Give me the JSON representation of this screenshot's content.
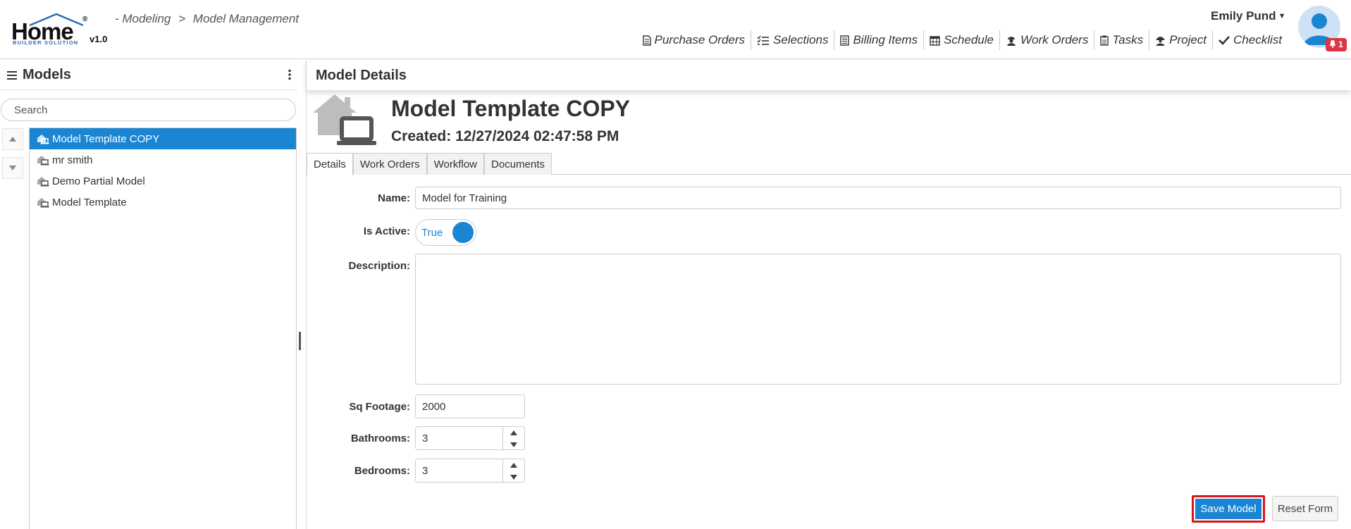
{
  "app": {
    "logo_word": "Home",
    "logo_reg": "®",
    "logo_sub": "BUILDER SOLUTION",
    "version": "v1.0",
    "accent_color": "#1a85d3"
  },
  "breadcrumb": {
    "section": "- Modeling",
    "separator": ">",
    "page": "Model Management"
  },
  "user": {
    "name": "Emily Pund",
    "notification_count": "1"
  },
  "nav": [
    {
      "label": "Purchase Orders",
      "icon": "document-icon"
    },
    {
      "label": "Selections",
      "icon": "checklist-icon"
    },
    {
      "label": "Billing Items",
      "icon": "ledger-icon"
    },
    {
      "label": "Schedule",
      "icon": "calendar-icon"
    },
    {
      "label": "Work Orders",
      "icon": "worker-icon"
    },
    {
      "label": "Tasks",
      "icon": "clipboard-icon"
    },
    {
      "label": "Project",
      "icon": "builder-icon"
    },
    {
      "label": "Checklist",
      "icon": "check-icon"
    }
  ],
  "left_panel": {
    "title": "Models",
    "search_placeholder": "Search",
    "items": [
      {
        "label": "Model Template COPY",
        "selected": true
      },
      {
        "label": "mr smith",
        "selected": false
      },
      {
        "label": "Demo Partial Model",
        "selected": false
      },
      {
        "label": "Model Template",
        "selected": false
      }
    ]
  },
  "details": {
    "panel_title": "Model Details",
    "model_name": "Model Template COPY",
    "created": "Created: 12/27/2024 02:47:58 PM",
    "tabs": [
      "Details",
      "Work Orders",
      "Workflow",
      "Documents"
    ],
    "active_tab": "Details",
    "form": {
      "name_label": "Name:",
      "name_value": "Model for Training",
      "active_label": "Is Active:",
      "active_value": "True",
      "description_label": "Description:",
      "description_value": "",
      "sqft_label": "Sq Footage:",
      "sqft_value": "2000",
      "bathrooms_label": "Bathrooms:",
      "bathrooms_value": "3",
      "bedrooms_label": "Bedrooms:",
      "bedrooms_value": "3"
    },
    "save_label": "Save Model",
    "reset_label": "Reset Form"
  }
}
